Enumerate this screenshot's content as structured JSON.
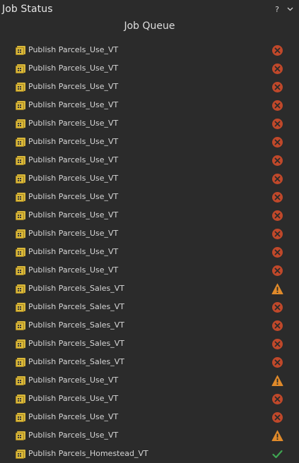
{
  "panel": {
    "title": "Job Status",
    "help_glyph": "?",
    "menu_glyph": "⌄"
  },
  "queue": {
    "heading": "Job Queue",
    "jobs": [
      {
        "name": "Publish Parcels_Use_VT",
        "status": "error"
      },
      {
        "name": "Publish Parcels_Use_VT",
        "status": "error"
      },
      {
        "name": "Publish Parcels_Use_VT",
        "status": "error"
      },
      {
        "name": "Publish Parcels_Use_VT",
        "status": "error"
      },
      {
        "name": "Publish Parcels_Use_VT",
        "status": "error"
      },
      {
        "name": "Publish Parcels_Use_VT",
        "status": "error"
      },
      {
        "name": "Publish Parcels_Use_VT",
        "status": "error"
      },
      {
        "name": "Publish Parcels_Use_VT",
        "status": "error"
      },
      {
        "name": "Publish Parcels_Use_VT",
        "status": "error"
      },
      {
        "name": "Publish Parcels_Use_VT",
        "status": "error"
      },
      {
        "name": "Publish Parcels_Use_VT",
        "status": "error"
      },
      {
        "name": "Publish Parcels_Use_VT",
        "status": "error"
      },
      {
        "name": "Publish Parcels_Use_VT",
        "status": "error"
      },
      {
        "name": "Publish Parcels_Sales_VT",
        "status": "warning"
      },
      {
        "name": "Publish Parcels_Sales_VT",
        "status": "error"
      },
      {
        "name": "Publish Parcels_Sales_VT",
        "status": "error"
      },
      {
        "name": "Publish Parcels_Sales_VT",
        "status": "error"
      },
      {
        "name": "Publish Parcels_Sales_VT",
        "status": "error"
      },
      {
        "name": "Publish Parcels_Use_VT",
        "status": "warning"
      },
      {
        "name": "Publish Parcels_Use_VT",
        "status": "error"
      },
      {
        "name": "Publish Parcels_Use_VT",
        "status": "error"
      },
      {
        "name": "Publish Parcels_Use_VT",
        "status": "warning"
      },
      {
        "name": "Publish Parcels_Homestead_VT",
        "status": "success"
      }
    ]
  },
  "colors": {
    "background": "#2b2b2b",
    "error": "#c0482a",
    "warning": "#e08a2a",
    "success": "#3fa552",
    "job_icon": "#d9b83a"
  },
  "icons": {
    "job": "publish-job-icon",
    "error": "error-circle-x-icon",
    "warning": "warning-triangle-icon",
    "success": "success-checkmark-icon"
  }
}
